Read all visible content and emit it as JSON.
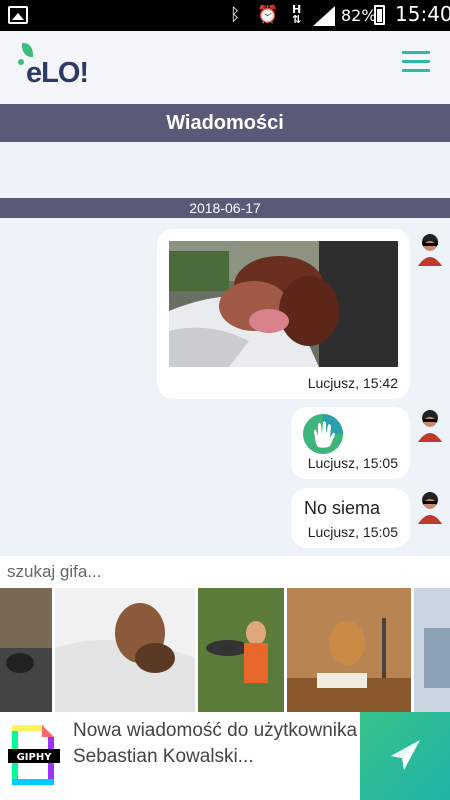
{
  "status_bar": {
    "battery": "82%",
    "time": "15:40"
  },
  "header": {
    "logo_text": "eLO!",
    "menu_icon": "hamburger-icon"
  },
  "title": "Wiadomości",
  "date_separator": "2018-06-17",
  "messages": [
    {
      "type": "gif",
      "meta": "Lucjusz, 15:42"
    },
    {
      "type": "emoji",
      "emoji": "wave-hand-icon",
      "meta": "Lucjusz, 15:05"
    },
    {
      "type": "text",
      "text": "No siema",
      "meta": "Lucjusz, 15:05"
    }
  ],
  "gif_search": {
    "placeholder": "szukaj gifa..."
  },
  "compose": {
    "giphy_label": "GIPHY",
    "placeholder": "Nowa wiadomość do użytkownika Sebastian Kowalski..."
  },
  "colors": {
    "accent": "#2bb9a3",
    "bar": "#585a77",
    "background": "#eef2f9"
  }
}
